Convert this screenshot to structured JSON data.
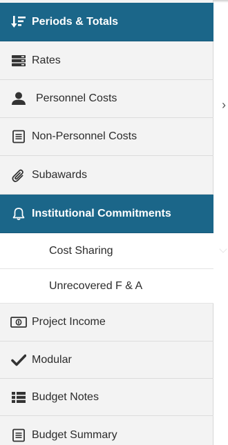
{
  "nav": {
    "items": [
      {
        "label": "Periods & Totals",
        "icon": "sort-amount-icon",
        "active": true
      },
      {
        "label": "Rates",
        "icon": "server-stack-icon"
      },
      {
        "label": "Personnel Costs",
        "icon": "person-icon"
      },
      {
        "label": "Non-Personnel Costs",
        "icon": "document-list-icon"
      },
      {
        "label": "Subawards",
        "icon": "paperclip-icon"
      },
      {
        "label": "Institutional Commitments",
        "icon": "bell-icon",
        "active": true
      },
      {
        "label": "Project Income",
        "icon": "money-bill-icon"
      },
      {
        "label": "Modular",
        "icon": "checkmark-icon"
      },
      {
        "label": "Budget Notes",
        "icon": "list-icon"
      },
      {
        "label": "Budget Summary",
        "icon": "document-list-icon"
      }
    ],
    "sub_items": [
      {
        "label": "Cost Sharing"
      },
      {
        "label": "Unrecovered F & A"
      }
    ],
    "expand_glyph": "›"
  },
  "colors": {
    "active_bg": "#1b6689",
    "nav_bg": "#f3f3f3",
    "text": "#2b2b2b"
  }
}
